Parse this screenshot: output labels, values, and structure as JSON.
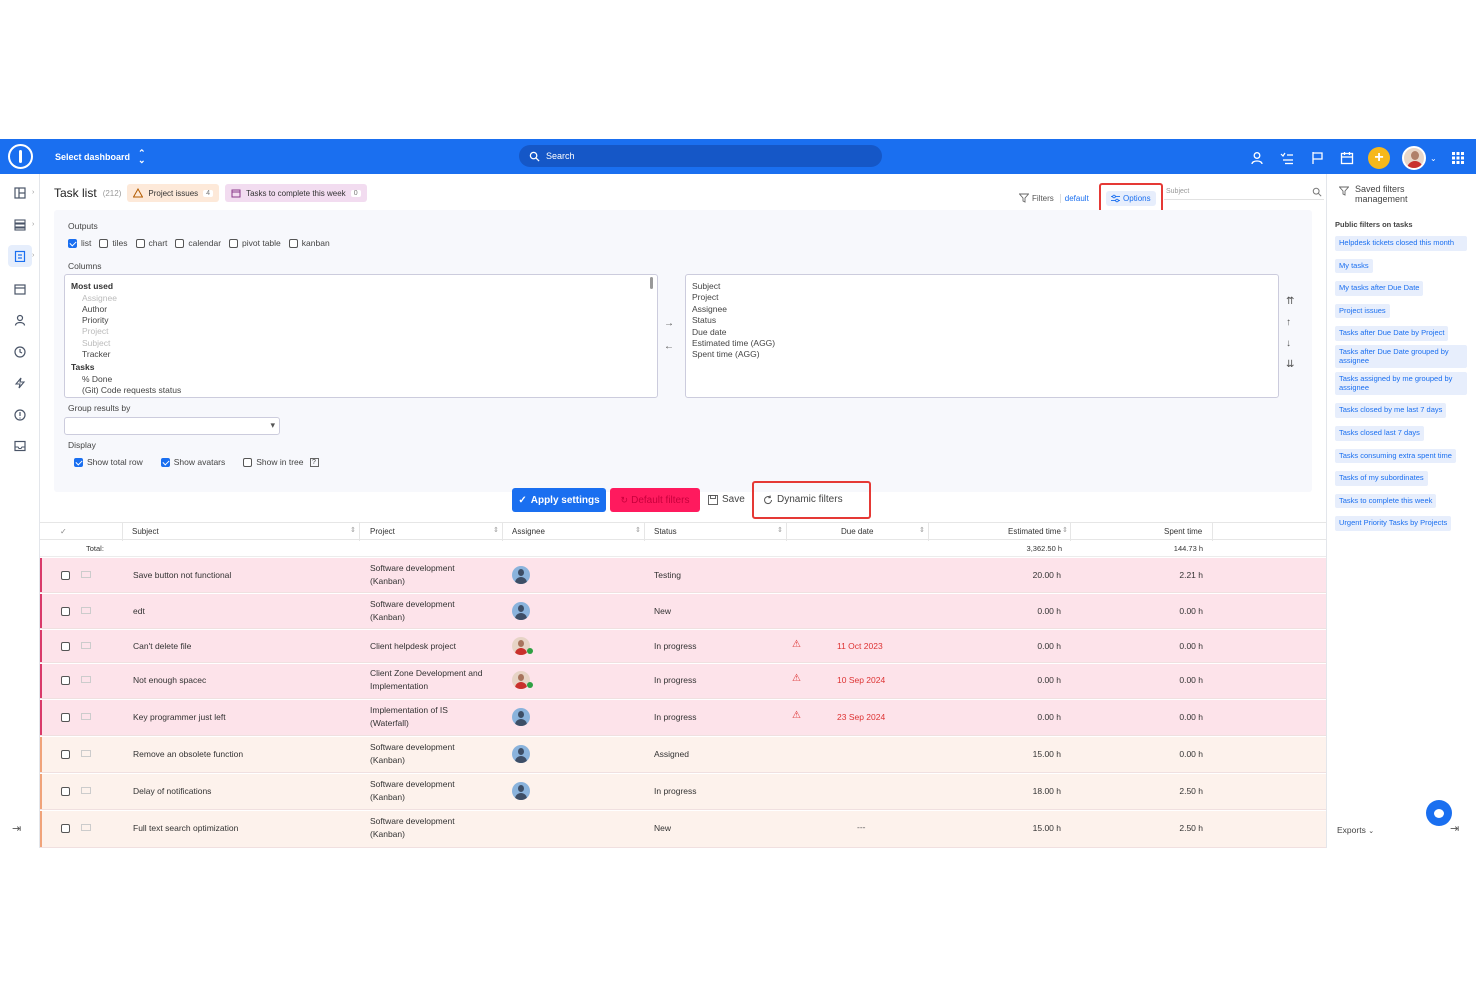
{
  "topbar": {
    "dashboard_label": "Select dashboard",
    "search_label": "Search"
  },
  "header": {
    "title": "Task list",
    "count": "(212)",
    "chips": [
      {
        "label": "Project issues",
        "count": "4"
      },
      {
        "label": "Tasks to complete this week",
        "count": "0"
      }
    ],
    "filters_label": "Filters",
    "default_label": "default",
    "options_label": "Options",
    "subject_placeholder": "Subject"
  },
  "options": {
    "outputs_label": "Outputs",
    "outputs": [
      {
        "label": "list",
        "checked": true
      },
      {
        "label": "tiles",
        "checked": false
      },
      {
        "label": "chart",
        "checked": false
      },
      {
        "label": "calendar",
        "checked": false
      },
      {
        "label": "pivot table",
        "checked": false
      },
      {
        "label": "kanban",
        "checked": false
      }
    ],
    "columns_label": "Columns",
    "available": {
      "group1": "Most used",
      "items1": [
        "Assignee",
        "Author",
        "Priority",
        "Project",
        "Subject",
        "Tracker"
      ],
      "group2": "Tasks",
      "items2": [
        "% Done",
        "(Git) Code requests status"
      ]
    },
    "selected": [
      "Subject",
      "Project",
      "Assignee",
      "Status",
      "Due date",
      "Estimated time (AGG)",
      "Spent time (AGG)"
    ],
    "group_by_label": "Group results by",
    "display_label": "Display",
    "display": [
      {
        "label": "Show total row",
        "checked": true
      },
      {
        "label": "Show avatars",
        "checked": true
      },
      {
        "label": "Show in tree",
        "checked": false
      }
    ],
    "apply_label": "Apply settings",
    "default_filters_label": "Default filters",
    "save_label": "Save",
    "dynamic_label": "Dynamic filters"
  },
  "table": {
    "headers": [
      "Subject",
      "Project",
      "Assignee",
      "Status",
      "Due date",
      "Estimated time",
      "Spent time"
    ],
    "total_label": "Total:",
    "total_estimated": "3,362.50 h",
    "total_spent": "144.73 h",
    "rows": [
      {
        "subject": "Save button not functional",
        "project1": "Software development",
        "project2": "(Kanban)",
        "status": "Testing",
        "due": "",
        "estimated": "20.00 h",
        "spent": "2.21 h"
      },
      {
        "subject": "edt",
        "project1": "Software development",
        "project2": "(Kanban)",
        "status": "New",
        "due": "",
        "estimated": "0.00 h",
        "spent": "0.00 h"
      },
      {
        "subject": "Can't delete file",
        "project1": "Client helpdesk project",
        "project2": "",
        "status": "In progress",
        "due": "11 Oct 2023",
        "estimated": "0.00 h",
        "spent": "0.00 h"
      },
      {
        "subject": "Not enough spacec",
        "project1": "Client Zone Development and",
        "project2": "Implementation",
        "status": "In progress",
        "due": "10 Sep 2024",
        "estimated": "0.00 h",
        "spent": "0.00 h"
      },
      {
        "subject": "Key programmer just left",
        "project1": "Implementation of IS",
        "project2": "(Waterfall)",
        "status": "In progress",
        "due": "23 Sep 2024",
        "estimated": "0.00 h",
        "spent": "0.00 h"
      },
      {
        "subject": "Remove an obsolete function",
        "project1": "Software development",
        "project2": "(Kanban)",
        "status": "Assigned",
        "due": "",
        "estimated": "15.00 h",
        "spent": "0.00 h"
      },
      {
        "subject": "Delay of notifications",
        "project1": "Software development",
        "project2": "(Kanban)",
        "status": "In progress",
        "due": "",
        "estimated": "18.00 h",
        "spent": "2.50 h"
      },
      {
        "subject": "Full text search optimization",
        "project1": "Software development",
        "project2": "(Kanban)",
        "status": "New",
        "due": "---",
        "estimated": "15.00 h",
        "spent": "2.50 h"
      }
    ]
  },
  "rightbar": {
    "title": "Saved filters management",
    "subtitle": "Public filters on tasks",
    "filters": [
      "Helpdesk tickets closed this month",
      "My tasks",
      "My tasks after Due Date",
      "Project issues",
      "Tasks after Due Date by Project",
      "Tasks after Due Date grouped by assignee",
      "Tasks assigned by me grouped by assignee",
      "Tasks closed by me last 7 days",
      "Tasks closed last 7 days",
      "Tasks consuming extra spent time",
      "Tasks of my subordinates",
      "Tasks to complete this week",
      "Urgent Priority Tasks by Projects"
    ],
    "exports_label": "Exports"
  }
}
